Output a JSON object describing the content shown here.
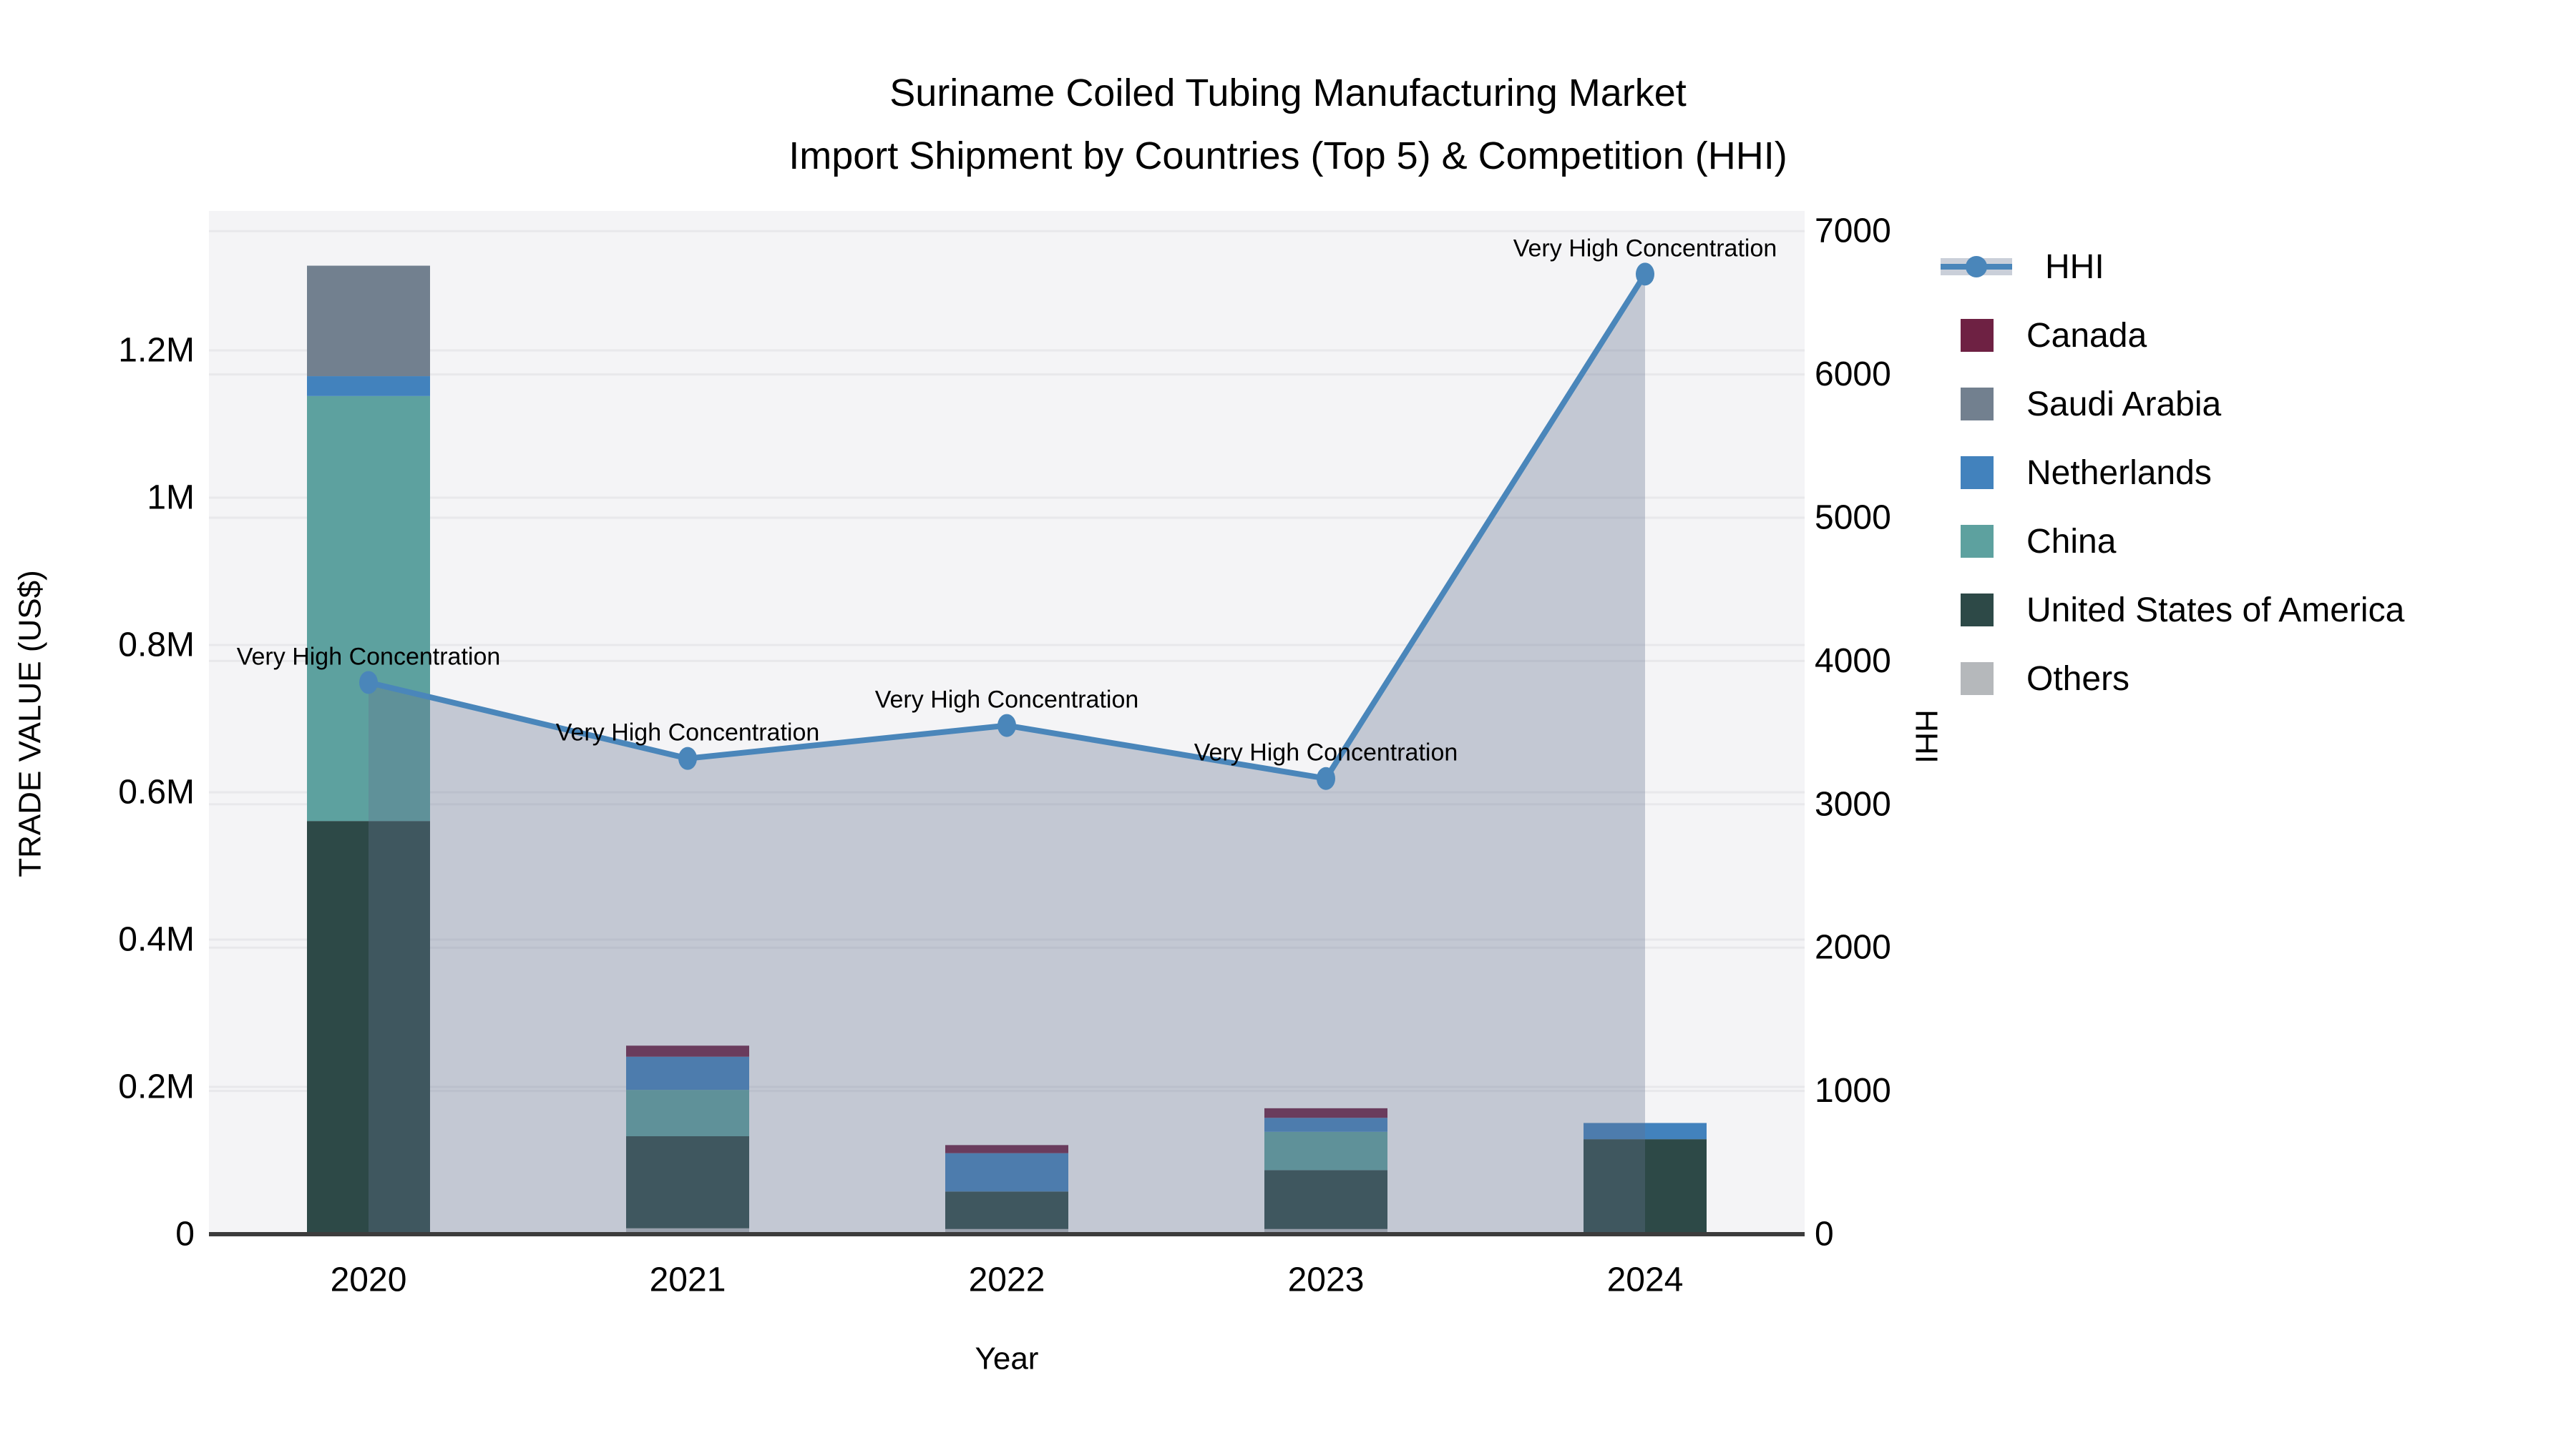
{
  "title": {
    "line1": "Suriname Coiled Tubing Manufacturing Market",
    "line2": "Import Shipment by Countries (Top 5) & Competition (HHI)"
  },
  "axes": {
    "left_title": "TRADE VALUE (US$)",
    "right_title": "HHI",
    "x_title": "Year",
    "left_ticks": [
      "0",
      "0.2M",
      "0.4M",
      "0.6M",
      "0.8M",
      "1M",
      "1.2M"
    ],
    "right_ticks": [
      "0",
      "1000",
      "2000",
      "3000",
      "4000",
      "5000",
      "6000",
      "7000"
    ]
  },
  "legend": {
    "items": [
      {
        "label": "HHI",
        "type": "line",
        "color": "#4a86ba",
        "band": "#cacfd9"
      },
      {
        "label": "Canada",
        "type": "box",
        "color": "#6e2143"
      },
      {
        "label": "Saudi Arabia",
        "type": "box",
        "color": "#72808f"
      },
      {
        "label": "Netherlands",
        "type": "box",
        "color": "#4282bd"
      },
      {
        "label": "China",
        "type": "box",
        "color": "#5da19f"
      },
      {
        "label": "United States of America",
        "type": "box",
        "color": "#2d4947"
      },
      {
        "label": "Others",
        "type": "box",
        "color": "#b5b8bb"
      }
    ]
  },
  "chart_data": {
    "type": "bar",
    "subtype": "stacked-bars-with-line",
    "title": "Suriname Coiled Tubing Manufacturing Market — Import Shipment by Countries (Top 5) & Competition (HHI)",
    "xlabel": "Year",
    "ylabel_left": "TRADE VALUE (US$)",
    "ylabel_right": "HHI",
    "categories": [
      "2020",
      "2021",
      "2022",
      "2023",
      "2024"
    ],
    "series": [
      {
        "name": "Canada",
        "color": "#6e2143",
        "values": [
          0,
          15000,
          11000,
          13000,
          0
        ]
      },
      {
        "name": "Saudi Arabia",
        "color": "#72808f",
        "values": [
          150000,
          0,
          0,
          0,
          0
        ]
      },
      {
        "name": "Netherlands",
        "color": "#4282bd",
        "values": [
          27000,
          45000,
          52000,
          19000,
          22000
        ]
      },
      {
        "name": "China",
        "color": "#5da19f",
        "values": [
          577000,
          63000,
          0,
          52000,
          0
        ]
      },
      {
        "name": "United States of America",
        "color": "#2d4947",
        "values": [
          561000,
          125000,
          51000,
          80000,
          129000
        ]
      },
      {
        "name": "Others",
        "color": "#b5b8bb",
        "values": [
          0,
          8000,
          7000,
          7000,
          0
        ]
      }
    ],
    "stack_order_bottom_to_top": [
      "Others",
      "United States of America",
      "China",
      "Netherlands",
      "Saudi Arabia",
      "Canada"
    ],
    "line_series": {
      "name": "HHI",
      "color": "#4a86ba",
      "area_fill": "rgba(100,113,145,0.34)",
      "values": [
        3850,
        3320,
        3550,
        3180,
        6700
      ]
    },
    "annotations": [
      {
        "x": "2020",
        "text": "Very High Concentration"
      },
      {
        "x": "2021",
        "text": "Very High Concentration"
      },
      {
        "x": "2022",
        "text": "Very High Concentration"
      },
      {
        "x": "2023",
        "text": "Very High Concentration"
      },
      {
        "x": "2024",
        "text": "Very High Concentration"
      }
    ],
    "left_axis": {
      "range": [
        0,
        1390000
      ],
      "tick_step": 200000
    },
    "right_axis": {
      "range": [
        0,
        7140
      ],
      "tick_step": 1000
    },
    "grid": true,
    "legend_position": "right",
    "plot_background": "#f4f4f6",
    "grid_color": "#e8e8eb",
    "axis_line_color": "#3c3c3c"
  }
}
